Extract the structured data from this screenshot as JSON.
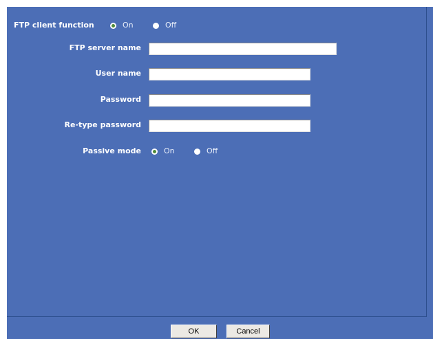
{
  "ftp_client": {
    "label": "FTP client function",
    "on_label": "On",
    "off_label": "Off",
    "selected": "On"
  },
  "fields": {
    "server_name": {
      "label": "FTP server name",
      "value": ""
    },
    "user_name": {
      "label": "User name",
      "value": ""
    },
    "password": {
      "label": "Password",
      "value": ""
    },
    "retype_password": {
      "label": "Re-type password",
      "value": ""
    }
  },
  "passive_mode": {
    "label": "Passive mode",
    "on_label": "On",
    "off_label": "Off",
    "selected": "On"
  },
  "buttons": {
    "ok": "OK",
    "cancel": "Cancel"
  },
  "colors": {
    "background": "#4c6eb6",
    "radio_selected": "#4e8a3a"
  }
}
